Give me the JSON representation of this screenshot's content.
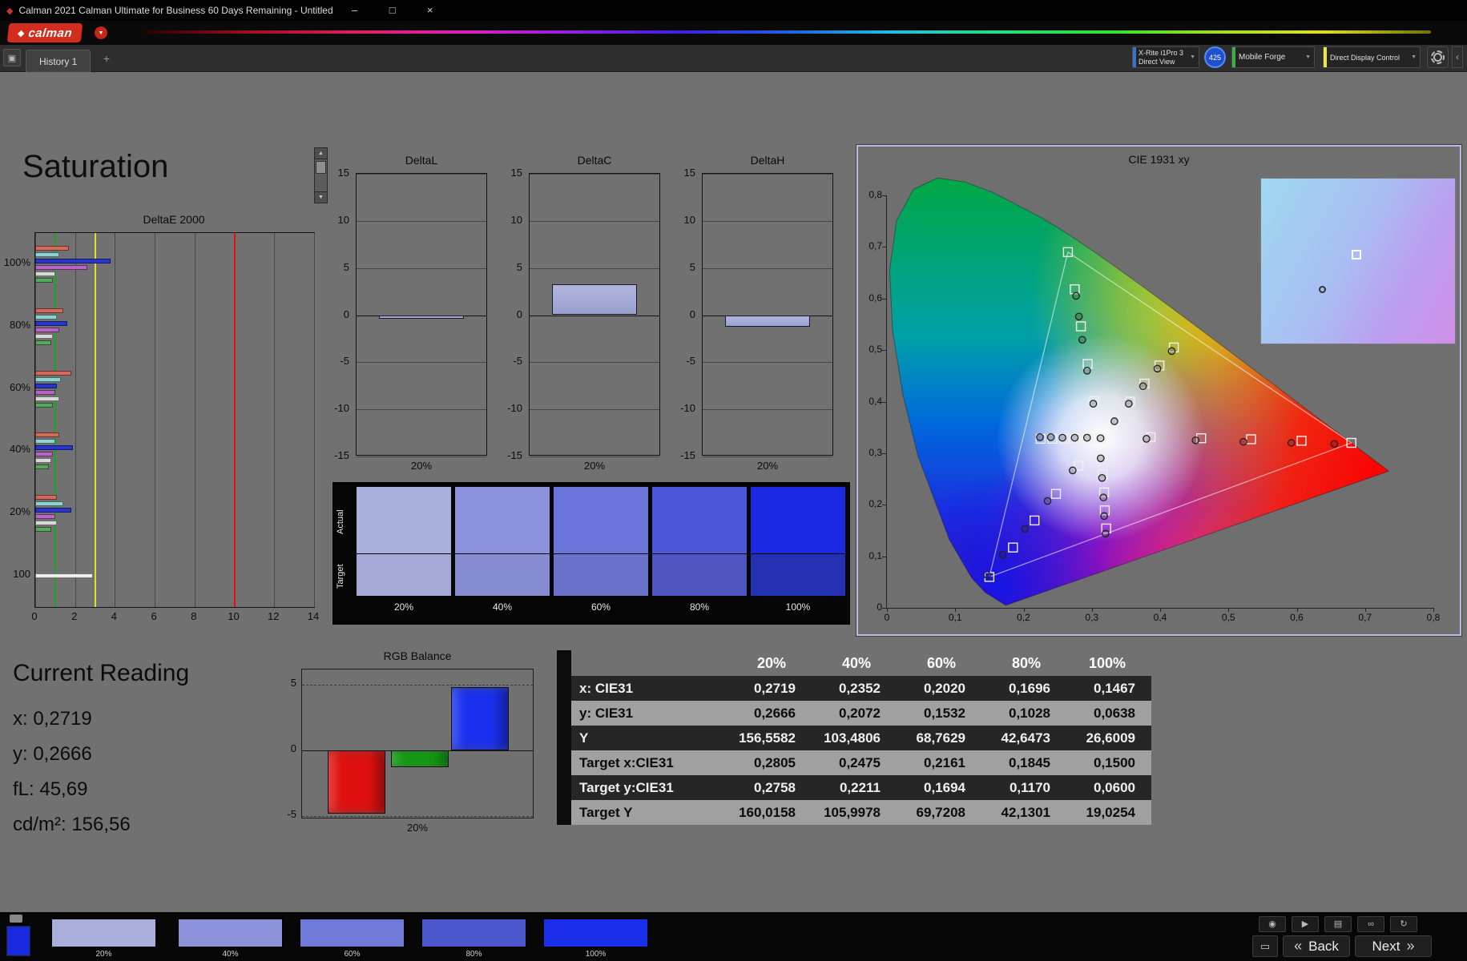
{
  "window": {
    "title": "Calman 2021 Calman Ultimate for Business 60 Days Remaining  - Untitled",
    "controls": {
      "minimize": "–",
      "maximize": "□",
      "close": "×"
    }
  },
  "icons": {
    "app_diamond": "◆",
    "logo_diamond": "◆",
    "dropdown_chevron": "▼",
    "history_panel": "▣",
    "add_tab": "+",
    "up_arrow": "▲",
    "down_arrow": "▼",
    "snapshot": "◉",
    "play": "▶",
    "printer": "▤",
    "view": "∞",
    "refresh": "↻",
    "monitor": "▭",
    "back_chevrons": "«",
    "next_chevrons": "»",
    "side_toggle": "‹"
  },
  "toolbar": {
    "logo_text": "calman",
    "spectrum_colors": [
      "#2a0004",
      "#a01020",
      "#e02060",
      "#e020c0",
      "#9020e0",
      "#4020e0",
      "#2060e0",
      "#20c0e0",
      "#20e080",
      "#30e030",
      "#a0e020",
      "#e0e020",
      "#707008"
    ],
    "devices": [
      {
        "label_line1": "X-Rite i1Pro 3",
        "label_line2": "Direct View",
        "accent": "#3a72c8"
      },
      {
        "label_line1": "Mobile Forge",
        "label_line2": "",
        "accent": "#3fae49"
      },
      {
        "label_line1": "Direct Display Control",
        "label_line2": "",
        "accent": "#e8e84a"
      }
    ],
    "badge": "425"
  },
  "tab_bar": {
    "tabs": [
      {
        "label": "History 1"
      }
    ]
  },
  "page": {
    "title": "Saturation"
  },
  "current_reading": {
    "title": "Current Reading",
    "x_label": "x: 0,2719",
    "y_label": "y: 0,2666",
    "fl_label": "fL: 45,69",
    "cdm2_label": "cd/m²: 156,56"
  },
  "swatch_panel": {
    "row_labels": [
      "Actual",
      "Target"
    ],
    "levels": [
      {
        "label": "20%",
        "actual": "#a9b0dd",
        "target": "#a5a9d5",
        "strip": "#a9aeda"
      },
      {
        "label": "40%",
        "actual": "#8a92dd",
        "target": "#868cd0",
        "strip": "#8b92da"
      },
      {
        "label": "60%",
        "actual": "#6b76dd",
        "target": "#6971cb",
        "strip": "#6f79d8"
      },
      {
        "label": "80%",
        "actual": "#4c58d9",
        "target": "#4e55c0",
        "strip": "#4b57cc"
      },
      {
        "label": "100%",
        "actual": "#1a2ae2",
        "target": "#2430b2",
        "strip": "#1a2de8"
      }
    ]
  },
  "bottom_bar": {
    "back_label": "Back",
    "next_label": "Next",
    "current_patch_color": "#1a2ae0"
  },
  "chart_data": [
    {
      "id": "deltae2000",
      "type": "bar",
      "orientation": "horizontal",
      "title": "DeltaE 2000",
      "xlim": [
        0,
        14
      ],
      "x_ticks": [
        0,
        2,
        4,
        6,
        8,
        10,
        12,
        14
      ],
      "ref_lines": [
        {
          "value": 1,
          "color": "#18a428"
        },
        {
          "value": 3,
          "color": "#e0e028"
        },
        {
          "value": 10,
          "color": "#e01414"
        }
      ],
      "groups": [
        {
          "label": "100%",
          "bars": [
            {
              "color": "#d4695c",
              "value": 1.7
            },
            {
              "color": "#8fd0d0",
              "value": 1.2
            },
            {
              "color": "#2a35cc",
              "value": 3.8
            },
            {
              "color": "#b964c4",
              "value": 2.6
            },
            {
              "color": "#d8d8d8",
              "value": 1.0
            },
            {
              "color": "#57a85c",
              "value": 0.9
            }
          ]
        },
        {
          "label": "80%",
          "bars": [
            {
              "color": "#d4695c",
              "value": 1.4
            },
            {
              "color": "#8fd0d0",
              "value": 1.1
            },
            {
              "color": "#2a35cc",
              "value": 1.6
            },
            {
              "color": "#b964c4",
              "value": 1.2
            },
            {
              "color": "#d8d8d8",
              "value": 0.9
            },
            {
              "color": "#57a85c",
              "value": 0.8
            }
          ]
        },
        {
          "label": "60%",
          "bars": [
            {
              "color": "#d4695c",
              "value": 1.8
            },
            {
              "color": "#8fd0d0",
              "value": 1.3
            },
            {
              "color": "#2a35cc",
              "value": 1.1
            },
            {
              "color": "#b964c4",
              "value": 1.0
            },
            {
              "color": "#d8d8d8",
              "value": 1.2
            },
            {
              "color": "#57a85c",
              "value": 0.9
            }
          ]
        },
        {
          "label": "40%",
          "bars": [
            {
              "color": "#d4695c",
              "value": 1.2
            },
            {
              "color": "#8fd0d0",
              "value": 1.0
            },
            {
              "color": "#2a35cc",
              "value": 1.9
            },
            {
              "color": "#b964c4",
              "value": 0.9
            },
            {
              "color": "#d8d8d8",
              "value": 0.8
            },
            {
              "color": "#57a85c",
              "value": 0.7
            }
          ]
        },
        {
          "label": "20%",
          "bars": [
            {
              "color": "#d4695c",
              "value": 1.1
            },
            {
              "color": "#8fd0d0",
              "value": 1.4
            },
            {
              "color": "#2a35cc",
              "value": 1.8
            },
            {
              "color": "#b964c4",
              "value": 1.0
            },
            {
              "color": "#d8d8d8",
              "value": 1.1
            },
            {
              "color": "#57a85c",
              "value": 0.8
            }
          ]
        },
        {
          "label": "100",
          "bars": [
            {
              "color": "#ececec",
              "value": 2.9
            }
          ]
        }
      ]
    },
    {
      "id": "delta_lch",
      "type": "bar",
      "ylim": [
        -15,
        15
      ],
      "y_ticks": [
        15,
        10,
        5,
        0,
        -5,
        -10,
        -15
      ],
      "x_label": "20%",
      "bar_color": "#b0b6de",
      "charts": [
        {
          "title": "DeltaL",
          "value": -0.4
        },
        {
          "title": "DeltaC",
          "value": 3.3
        },
        {
          "title": "DeltaH",
          "value": -1.2
        }
      ]
    },
    {
      "id": "cie1931",
      "type": "scatter",
      "title": "CIE 1931 xy",
      "xlim": [
        0,
        0.8
      ],
      "ylim": [
        0,
        0.8
      ],
      "x_ticks": [
        "0",
        "0,1",
        "0,2",
        "0,3",
        "0,4",
        "0,5",
        "0,6",
        "0,7",
        "0,8"
      ],
      "y_ticks": [
        "0,8",
        "0,7",
        "0,6",
        "0,5",
        "0,4",
        "0,3",
        "0,2",
        "0,1",
        "0"
      ],
      "white_point": [
        0.3127,
        0.329
      ],
      "gamut_triangle": [
        [
          0.68,
          0.32
        ],
        [
          0.265,
          0.69
        ],
        [
          0.15,
          0.06
        ]
      ],
      "inset": {
        "square": [
          0.49,
          0.46
        ],
        "circle": [
          0.315,
          0.67
        ]
      },
      "sweeps": [
        {
          "name": "red",
          "targets": [
            [
              0.386,
              0.331
            ],
            [
              0.46,
              0.329
            ],
            [
              0.533,
              0.327
            ],
            [
              0.607,
              0.324
            ],
            [
              0.68,
              0.32
            ]
          ],
          "measured": [
            [
              0.38,
              0.328
            ],
            [
              0.452,
              0.325
            ],
            [
              0.522,
              0.322
            ],
            [
              0.592,
              0.32
            ],
            [
              0.655,
              0.318
            ]
          ]
        },
        {
          "name": "green",
          "targets": [
            [
              0.303,
              0.401
            ],
            [
              0.294,
              0.473
            ],
            [
              0.284,
              0.546
            ],
            [
              0.275,
              0.618
            ],
            [
              0.265,
              0.69
            ]
          ],
          "measured": [
            [
              0.302,
              0.396
            ],
            [
              0.293,
              0.46
            ],
            [
              0.286,
              0.52
            ],
            [
              0.281,
              0.565
            ],
            [
              0.277,
              0.605
            ]
          ]
        },
        {
          "name": "blue",
          "targets": [
            [
              0.2805,
              0.2758
            ],
            [
              0.2475,
              0.2211
            ],
            [
              0.2161,
              0.1694
            ],
            [
              0.1845,
              0.117
            ],
            [
              0.15,
              0.06
            ]
          ],
          "measured": [
            [
              0.2719,
              0.2666
            ],
            [
              0.2352,
              0.2072
            ],
            [
              0.202,
              0.1532
            ],
            [
              0.1696,
              0.1028
            ],
            [
              0.1467,
              0.0638
            ]
          ]
        },
        {
          "name": "cyan",
          "targets": [
            [
              0.295,
              0.329
            ],
            [
              0.277,
              0.329
            ],
            [
              0.26,
              0.328
            ],
            [
              0.242,
              0.328
            ],
            [
              0.225,
              0.328
            ]
          ],
          "measured": [
            [
              0.293,
              0.33
            ],
            [
              0.275,
              0.33
            ],
            [
              0.257,
              0.33
            ],
            [
              0.24,
              0.331
            ],
            [
              0.224,
              0.331
            ]
          ]
        },
        {
          "name": "magenta",
          "targets": [
            [
              0.314,
              0.294
            ],
            [
              0.316,
              0.259
            ],
            [
              0.318,
              0.224
            ],
            [
              0.319,
              0.189
            ],
            [
              0.321,
              0.154
            ]
          ],
          "measured": [
            [
              0.313,
              0.29
            ],
            [
              0.315,
              0.252
            ],
            [
              0.317,
              0.214
            ],
            [
              0.318,
              0.178
            ],
            [
              0.32,
              0.144
            ]
          ]
        },
        {
          "name": "yellow",
          "targets": [
            [
              0.334,
              0.364
            ],
            [
              0.356,
              0.4
            ],
            [
              0.377,
              0.435
            ],
            [
              0.399,
              0.47
            ],
            [
              0.42,
              0.505
            ]
          ],
          "measured": [
            [
              0.333,
              0.362
            ],
            [
              0.354,
              0.396
            ],
            [
              0.375,
              0.43
            ],
            [
              0.396,
              0.464
            ],
            [
              0.417,
              0.498
            ]
          ]
        }
      ]
    },
    {
      "id": "rgb_balance",
      "type": "bar",
      "title": "RGB Balance",
      "ylim": [
        -5.3,
        6.2
      ],
      "y_ticks": [
        5,
        0,
        -5
      ],
      "x_label": "20%",
      "bars": [
        {
          "name": "red",
          "color": "#e01010",
          "value": -4.8
        },
        {
          "name": "green",
          "color": "#0fa00f",
          "value": -1.3
        },
        {
          "name": "blue",
          "color": "#1a30f0",
          "value": 4.8
        }
      ]
    },
    {
      "id": "saturation_table",
      "type": "table",
      "columns": [
        "",
        "20%",
        "40%",
        "60%",
        "80%",
        "100%"
      ],
      "rows": [
        {
          "label": "x: CIE31",
          "values": [
            "0,2719",
            "0,2352",
            "0,2020",
            "0,1696",
            "0,1467"
          ]
        },
        {
          "label": "y: CIE31",
          "values": [
            "0,2666",
            "0,2072",
            "0,1532",
            "0,1028",
            "0,0638"
          ]
        },
        {
          "label": "Y",
          "values": [
            "156,5582",
            "103,4806",
            "68,7629",
            "42,6473",
            "26,6009"
          ]
        },
        {
          "label": "Target x:CIE31",
          "values": [
            "0,2805",
            "0,2475",
            "0,2161",
            "0,1845",
            "0,1500"
          ]
        },
        {
          "label": "Target y:CIE31",
          "values": [
            "0,2758",
            "0,2211",
            "0,1694",
            "0,1170",
            "0,0600"
          ]
        },
        {
          "label": "Target Y",
          "values": [
            "160,0158",
            "105,9978",
            "69,7208",
            "42,1301",
            "19,0254"
          ]
        }
      ]
    }
  ]
}
